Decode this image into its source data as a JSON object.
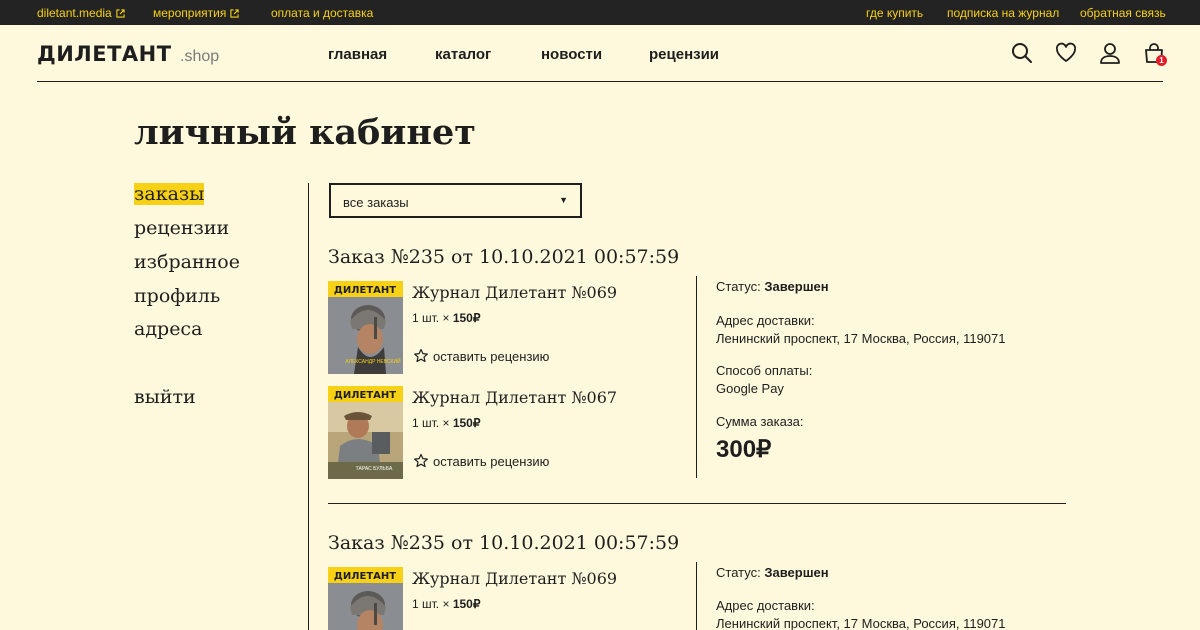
{
  "topbar": {
    "left_links": [
      "diletant.media",
      "мероприятия",
      "оплата и доставка"
    ],
    "right_links": [
      "где купить",
      "подписка на журнал",
      "обратная связь"
    ]
  },
  "header": {
    "logo": "ДИЛЕТАНТ",
    "logo_suffix": ".shop",
    "nav": [
      "главная",
      "каталог",
      "новости",
      "рецензии"
    ],
    "icons": [
      "search-icon",
      "heart-icon",
      "user-icon",
      "cart-icon"
    ],
    "cart_count": "1"
  },
  "page_title": "личный кабинет",
  "sidebar": {
    "items": [
      "заказы",
      "рецензии",
      "избранное",
      "профиль",
      "адреса"
    ],
    "logout": "выйти"
  },
  "filter": {
    "selected": "все заказы",
    "caret": "▼"
  },
  "orders": [
    {
      "title": "Заказ №235 от 10.10.2021 00:57:59",
      "items": [
        {
          "name": "Журнал Дилетант №069",
          "qty": "1 шт. ×",
          "price": "150₽",
          "review": "оставить рецензию",
          "cover_caption": "АЛЕКСАНДР НЕВСКИЙ"
        },
        {
          "name": "Журнал Дилетант №067",
          "qty": "1 шт. ×",
          "price": "150₽",
          "review": "оставить рецензию",
          "cover_caption": "ТАРАС БУЛЬБА"
        }
      ],
      "status_label": "Статус:",
      "status": "Завершен",
      "address_label": "Адрес доставки:",
      "address": "Ленинский проспект, 17 Москва, Россия, 119071",
      "payment_label": "Способ оплаты:",
      "payment": "Google Pay",
      "total_label": "Сумма заказа:",
      "total": "300₽"
    },
    {
      "title": "Заказ №235 от 10.10.2021 00:57:59",
      "items": [
        {
          "name": "Журнал Дилетант №069",
          "qty": "1 шт. ×",
          "price": "150₽"
        }
      ],
      "status_label": "Статус:",
      "status": "Завершен",
      "address_label": "Адрес доставки:",
      "address": "Ленинский проспект, 17 Москва, Россия, 119071"
    }
  ],
  "colors": {
    "accent": "#f7d116",
    "background": "#fef9dc",
    "topbar": "#232323",
    "badge": "#e11d2a"
  }
}
